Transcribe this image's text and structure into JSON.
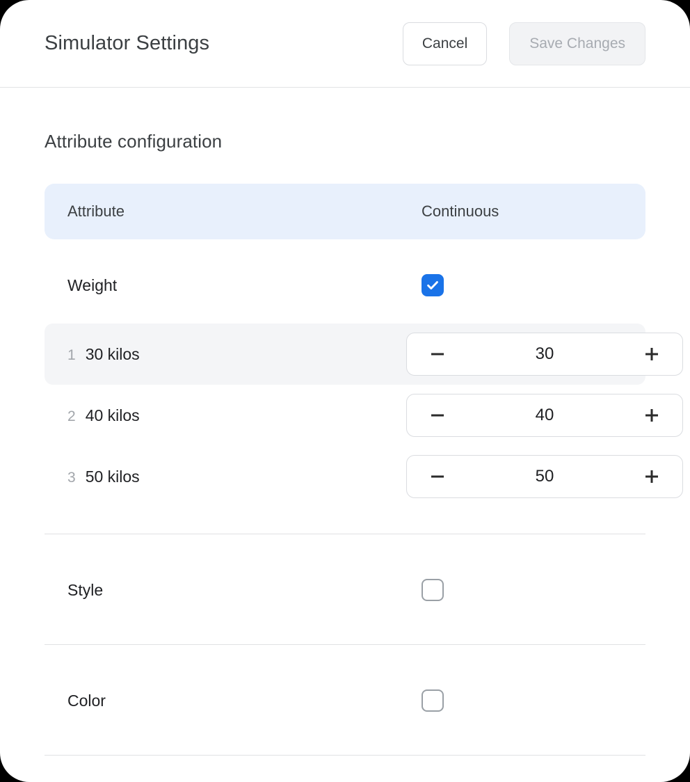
{
  "header": {
    "title": "Simulator Settings",
    "cancel_label": "Cancel",
    "save_label": "Save Changes"
  },
  "main": {
    "section_title": "Attribute configuration",
    "table": {
      "columns": {
        "attribute": "Attribute",
        "continuous": "Continuous"
      },
      "attributes": [
        {
          "name": "Weight",
          "continuous": true,
          "checkbox_icon": "checkbox-checked-icon",
          "values": [
            {
              "index": "1",
              "label": "30 kilos",
              "amount": "30",
              "highlighted": true
            },
            {
              "index": "2",
              "label": "40 kilos",
              "amount": "40",
              "highlighted": false
            },
            {
              "index": "3",
              "label": "50 kilos",
              "amount": "50",
              "highlighted": false
            }
          ]
        },
        {
          "name": "Style",
          "continuous": false,
          "checkbox_icon": "checkbox-unchecked-icon",
          "values": []
        },
        {
          "name": "Color",
          "continuous": false,
          "checkbox_icon": "checkbox-unchecked-icon",
          "values": []
        }
      ]
    },
    "stepper": {
      "decrement_icon": "minus-icon",
      "increment_icon": "plus-icon"
    }
  },
  "colors": {
    "accent": "#1a73e8",
    "table_header_bg": "#e8f0fc",
    "row_highlight_bg": "#f4f5f7",
    "divider": "#e0e1e3",
    "text_primary": "#202124",
    "text_secondary": "#3c4043",
    "text_muted": "#a2a6ab",
    "disabled_text": "#a7abb1"
  }
}
